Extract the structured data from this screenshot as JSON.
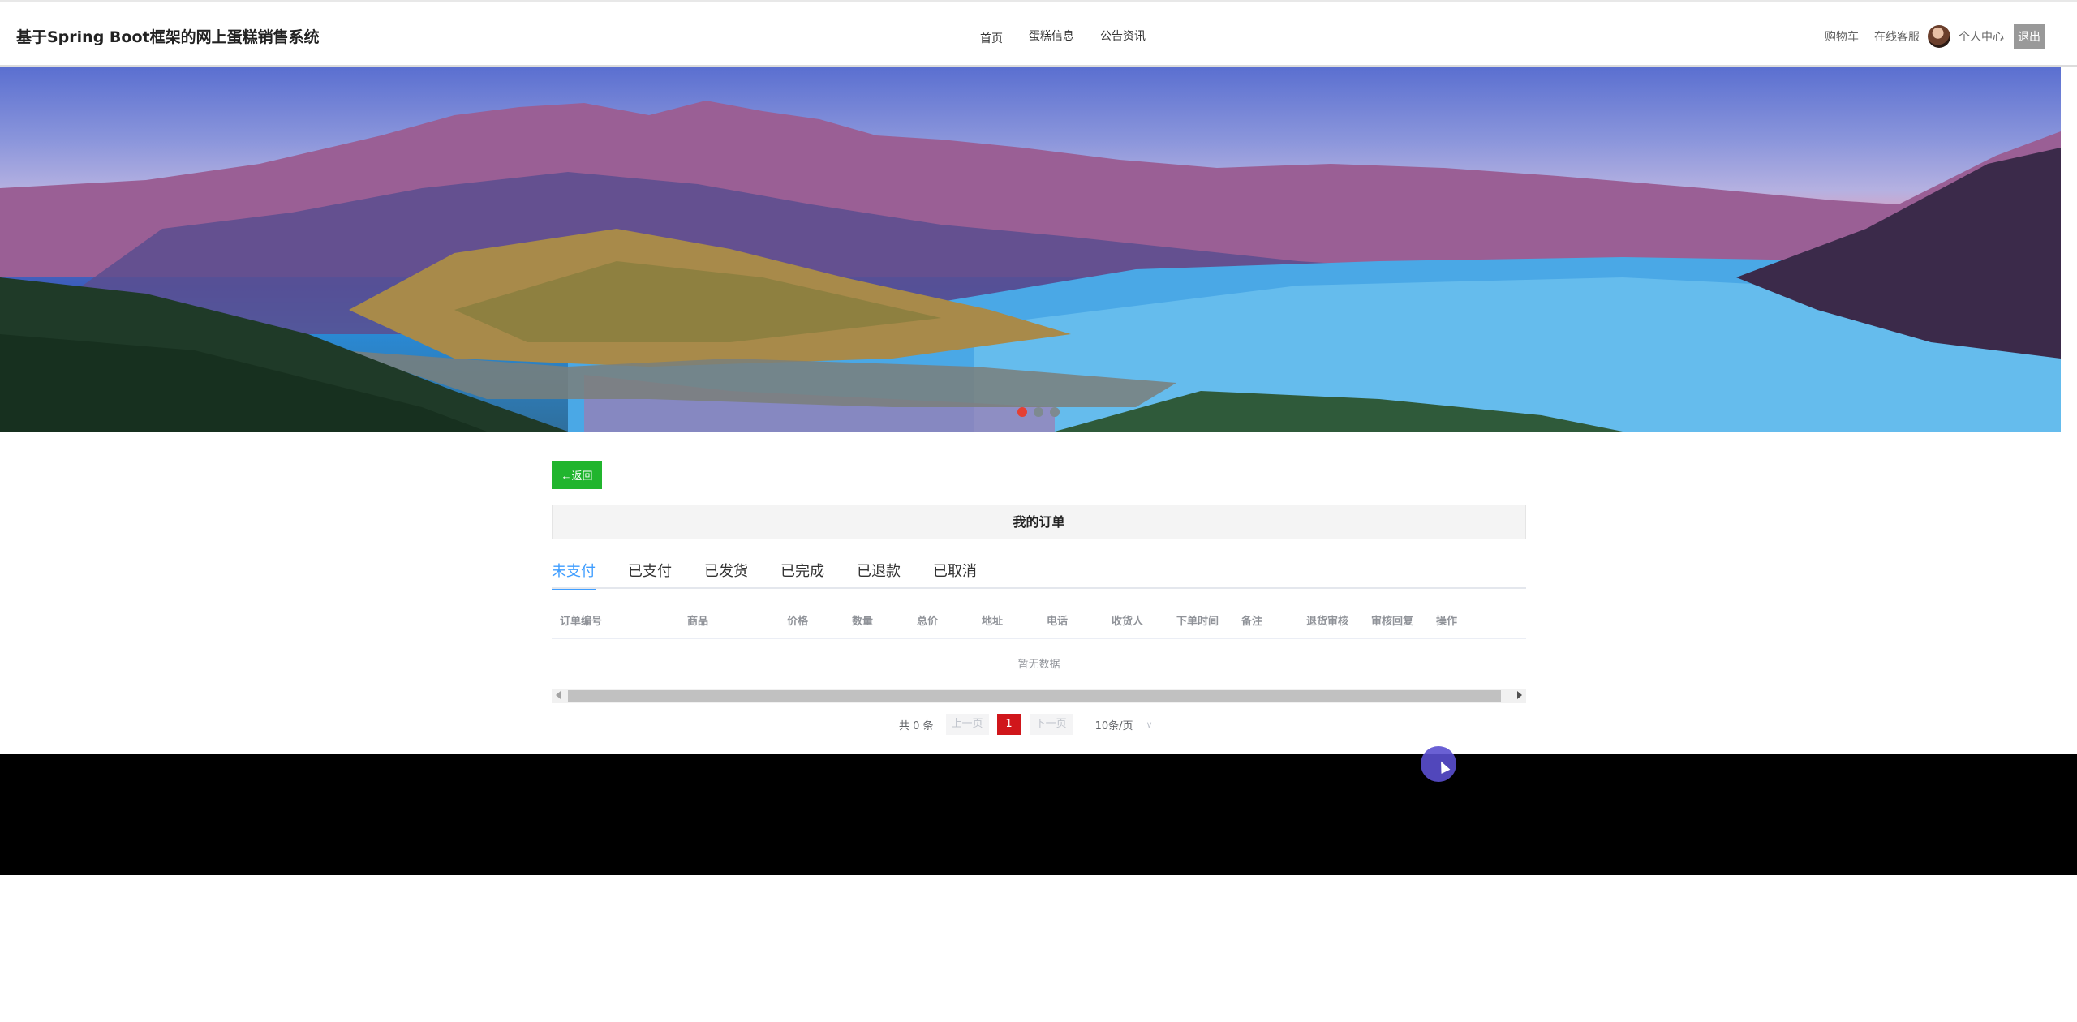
{
  "header": {
    "brand": "基于Spring Boot框架的网上蛋糕销售系统",
    "nav": [
      "首页",
      "蛋糕信息",
      "公告资讯"
    ],
    "right": {
      "cart": "购物车",
      "service": "在线客服",
      "profile": "个人中心",
      "logout": "退出"
    }
  },
  "banner": {
    "slides": 3,
    "active_slide": 1
  },
  "content": {
    "back_label": "←返回",
    "panel_title": "我的订单",
    "tabs": [
      "未支付",
      "已支付",
      "已发货",
      "已完成",
      "已退款",
      "已取消"
    ],
    "active_tab": "未支付",
    "columns": [
      "订单编号",
      "商品",
      "价格",
      "数量",
      "总价",
      "地址",
      "电话",
      "收货人",
      "下单时间",
      "备注",
      "退货审核",
      "审核回复",
      "操作"
    ],
    "empty_text": "暂无数据"
  },
  "pagination": {
    "total": "共 0 条",
    "prev": "上一页",
    "current": "1",
    "next": "下一页",
    "page_size": "10条/页"
  },
  "colors": {
    "accent": "#409eff",
    "back_button": "#21b52e",
    "active_page": "#d0161b"
  }
}
